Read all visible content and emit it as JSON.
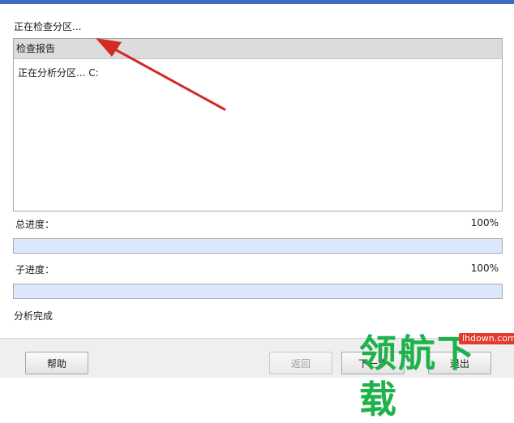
{
  "status_heading": "正在检查分区...",
  "report": {
    "header": "检查报告",
    "lines": [
      "正在分析分区... C:"
    ]
  },
  "progress": {
    "total": {
      "label": "总进度：",
      "percent_text": "100%",
      "fraction": 1.0
    },
    "sub": {
      "label": "子进度：",
      "percent_text": "100%",
      "fraction": 1.0
    }
  },
  "final_status": "分析完成",
  "buttons": {
    "help": "帮助",
    "back": "返回",
    "next": "下一步",
    "exit": "退出"
  },
  "watermark": {
    "logo_text": "领航下载",
    "url": "lhdown.com"
  },
  "colors": {
    "annotation_arrow": "#d42a26",
    "watermark_green": "#20b24a"
  }
}
